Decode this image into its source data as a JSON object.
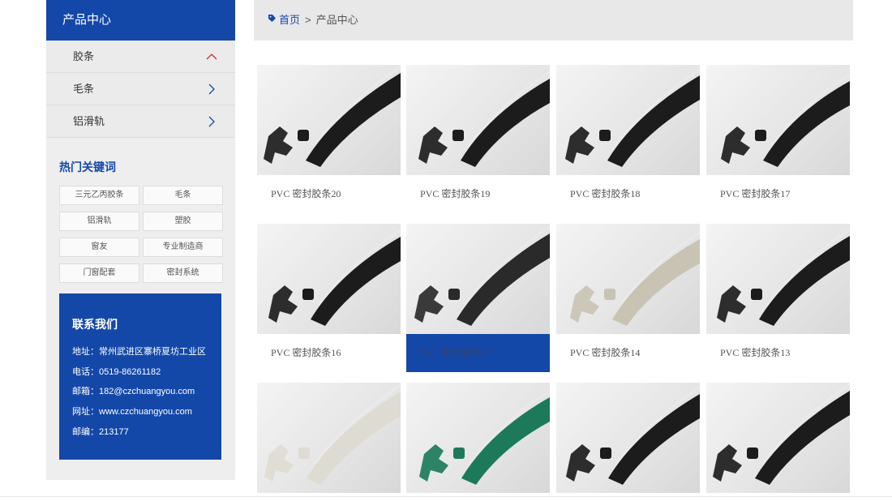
{
  "sidebar": {
    "title": "产品中心",
    "categories": [
      {
        "label": "胶条",
        "state": "expanded"
      },
      {
        "label": "毛条",
        "state": "collapsed"
      },
      {
        "label": "铝滑轨",
        "state": "collapsed"
      }
    ],
    "hot_title": "热门关键词",
    "tags": [
      "三元乙丙胶条",
      "毛条",
      "铝滑轨",
      "塑胶",
      "窗友",
      "专业制造商",
      "门窗配套",
      "密封系统"
    ],
    "contact": {
      "title": "联系我们",
      "address": "地址：常州武进区寨桥夏坊工业区",
      "phone": "电话：0519-86261182",
      "email": "邮箱：182@czchuangyou.com",
      "website": "网址：www.czchuangyou.com",
      "postcode": "邮编：213177"
    }
  },
  "breadcrumb": {
    "home": "首页",
    "separator": ">",
    "current": "产品中心"
  },
  "products": [
    {
      "label": "PVC 密封胶条20",
      "color": "#1c1c1c"
    },
    {
      "label": "PVC 密封胶条19",
      "color": "#1c1c1c"
    },
    {
      "label": "PVC 密封胶条18",
      "color": "#1c1c1c"
    },
    {
      "label": "PVC 密封胶条17",
      "color": "#1c1c1c"
    },
    {
      "label": "PVC 密封胶条16",
      "color": "#1c1c1c"
    },
    {
      "label": "PVC 密封胶条15",
      "color": "#2a2a2a"
    },
    {
      "label": "PVC 密封胶条14",
      "color": "#c9c3b3"
    },
    {
      "label": "PVC 密封胶条13",
      "color": "#1c1c1c"
    },
    {
      "label": "",
      "color": "#dedbd2"
    },
    {
      "label": "",
      "color": "#1c7a5a"
    },
    {
      "label": "",
      "color": "#1c1c1c"
    },
    {
      "label": "",
      "color": "#1c1c1c"
    }
  ],
  "colors": {
    "brand": "#1448a8",
    "accent_red": "#d9262c"
  },
  "icons": {
    "breadcrumb": "tag-icon",
    "expanded": "chevron-up-icon",
    "collapsed": "chevron-right-icon"
  }
}
